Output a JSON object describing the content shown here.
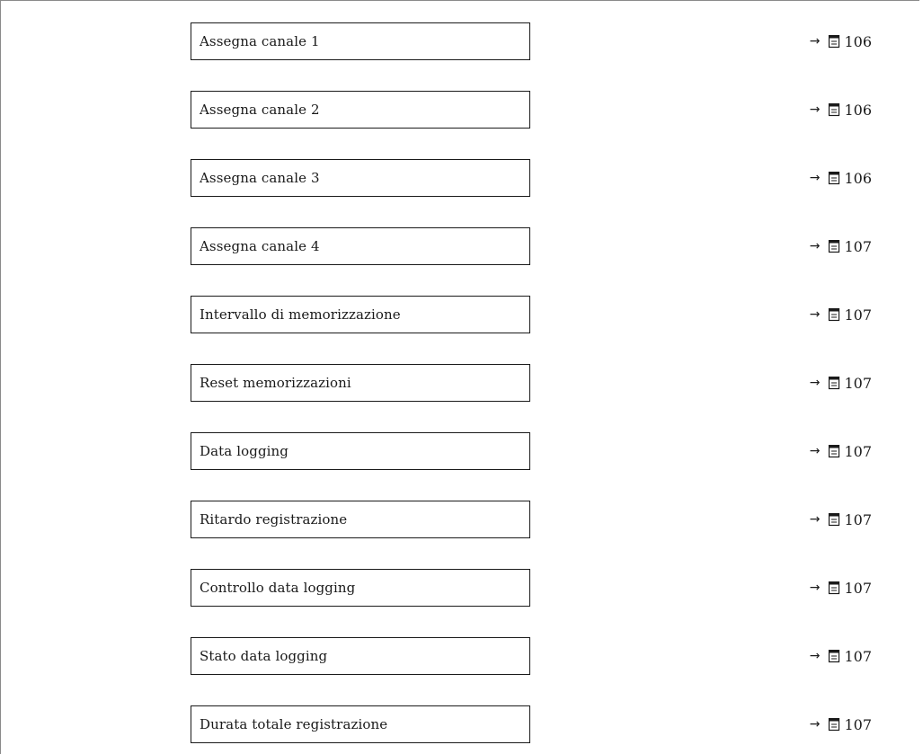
{
  "rows": [
    {
      "label": "Assegna canale 1",
      "page": "106"
    },
    {
      "label": "Assegna canale 2",
      "page": "106"
    },
    {
      "label": "Assegna canale 3",
      "page": "106"
    },
    {
      "label": "Assegna canale 4",
      "page": "107"
    },
    {
      "label": "Intervallo di memorizzazione",
      "page": "107"
    },
    {
      "label": "Reset memorizzazioni",
      "page": "107"
    },
    {
      "label": "Data logging",
      "page": "107"
    },
    {
      "label": "Ritardo registrazione",
      "page": "107"
    },
    {
      "label": "Controllo data logging",
      "page": "107"
    },
    {
      "label": "Stato data logging",
      "page": "107"
    },
    {
      "label": "Durata totale registrazione",
      "page": "107"
    }
  ],
  "ref_arrow": "→",
  "ref_icon": "book-icon",
  "colors": {
    "border": "#1a1a1a",
    "frame": "#8a8a8a",
    "text": "#1a1a1a"
  }
}
